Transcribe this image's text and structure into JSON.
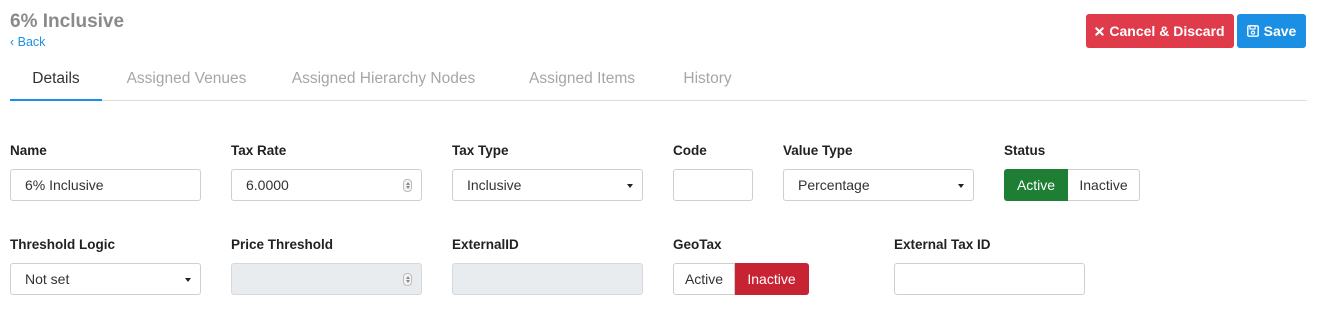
{
  "header": {
    "title": "6% Inclusive",
    "back_label": "‹ Back",
    "cancel_label": "Cancel & Discard",
    "save_label": "Save"
  },
  "tabs": [
    {
      "label": "Details",
      "active": true
    },
    {
      "label": "Assigned Venues",
      "active": false
    },
    {
      "label": "Assigned Hierarchy Nodes",
      "active": false
    },
    {
      "label": "Assigned Items",
      "active": false
    },
    {
      "label": "History",
      "active": false
    }
  ],
  "form": {
    "name": {
      "label": "Name",
      "value": "6% Inclusive"
    },
    "tax_rate": {
      "label": "Tax Rate",
      "value": "6.0000"
    },
    "tax_type": {
      "label": "Tax Type",
      "value": "Inclusive"
    },
    "code": {
      "label": "Code",
      "value": ""
    },
    "value_type": {
      "label": "Value Type",
      "value": "Percentage"
    },
    "status": {
      "label": "Status",
      "options": [
        "Active",
        "Inactive"
      ],
      "selected": "Active"
    },
    "threshold_logic": {
      "label": "Threshold Logic",
      "value": "Not set"
    },
    "price_threshold": {
      "label": "Price Threshold",
      "value": ""
    },
    "external_id": {
      "label": "ExternalID",
      "value": ""
    },
    "geotax": {
      "label": "GeoTax",
      "options": [
        "Active",
        "Inactive"
      ],
      "selected": "Inactive"
    },
    "external_tax_id": {
      "label": "External Tax ID",
      "value": ""
    }
  },
  "colors": {
    "accent": "#1a8fe3",
    "danger": "#e03b4b",
    "active_green": "#1e7e34",
    "inactive_red": "#c82333"
  },
  "icons": {
    "cancel": "times-icon",
    "save": "floppy-disk-icon"
  }
}
